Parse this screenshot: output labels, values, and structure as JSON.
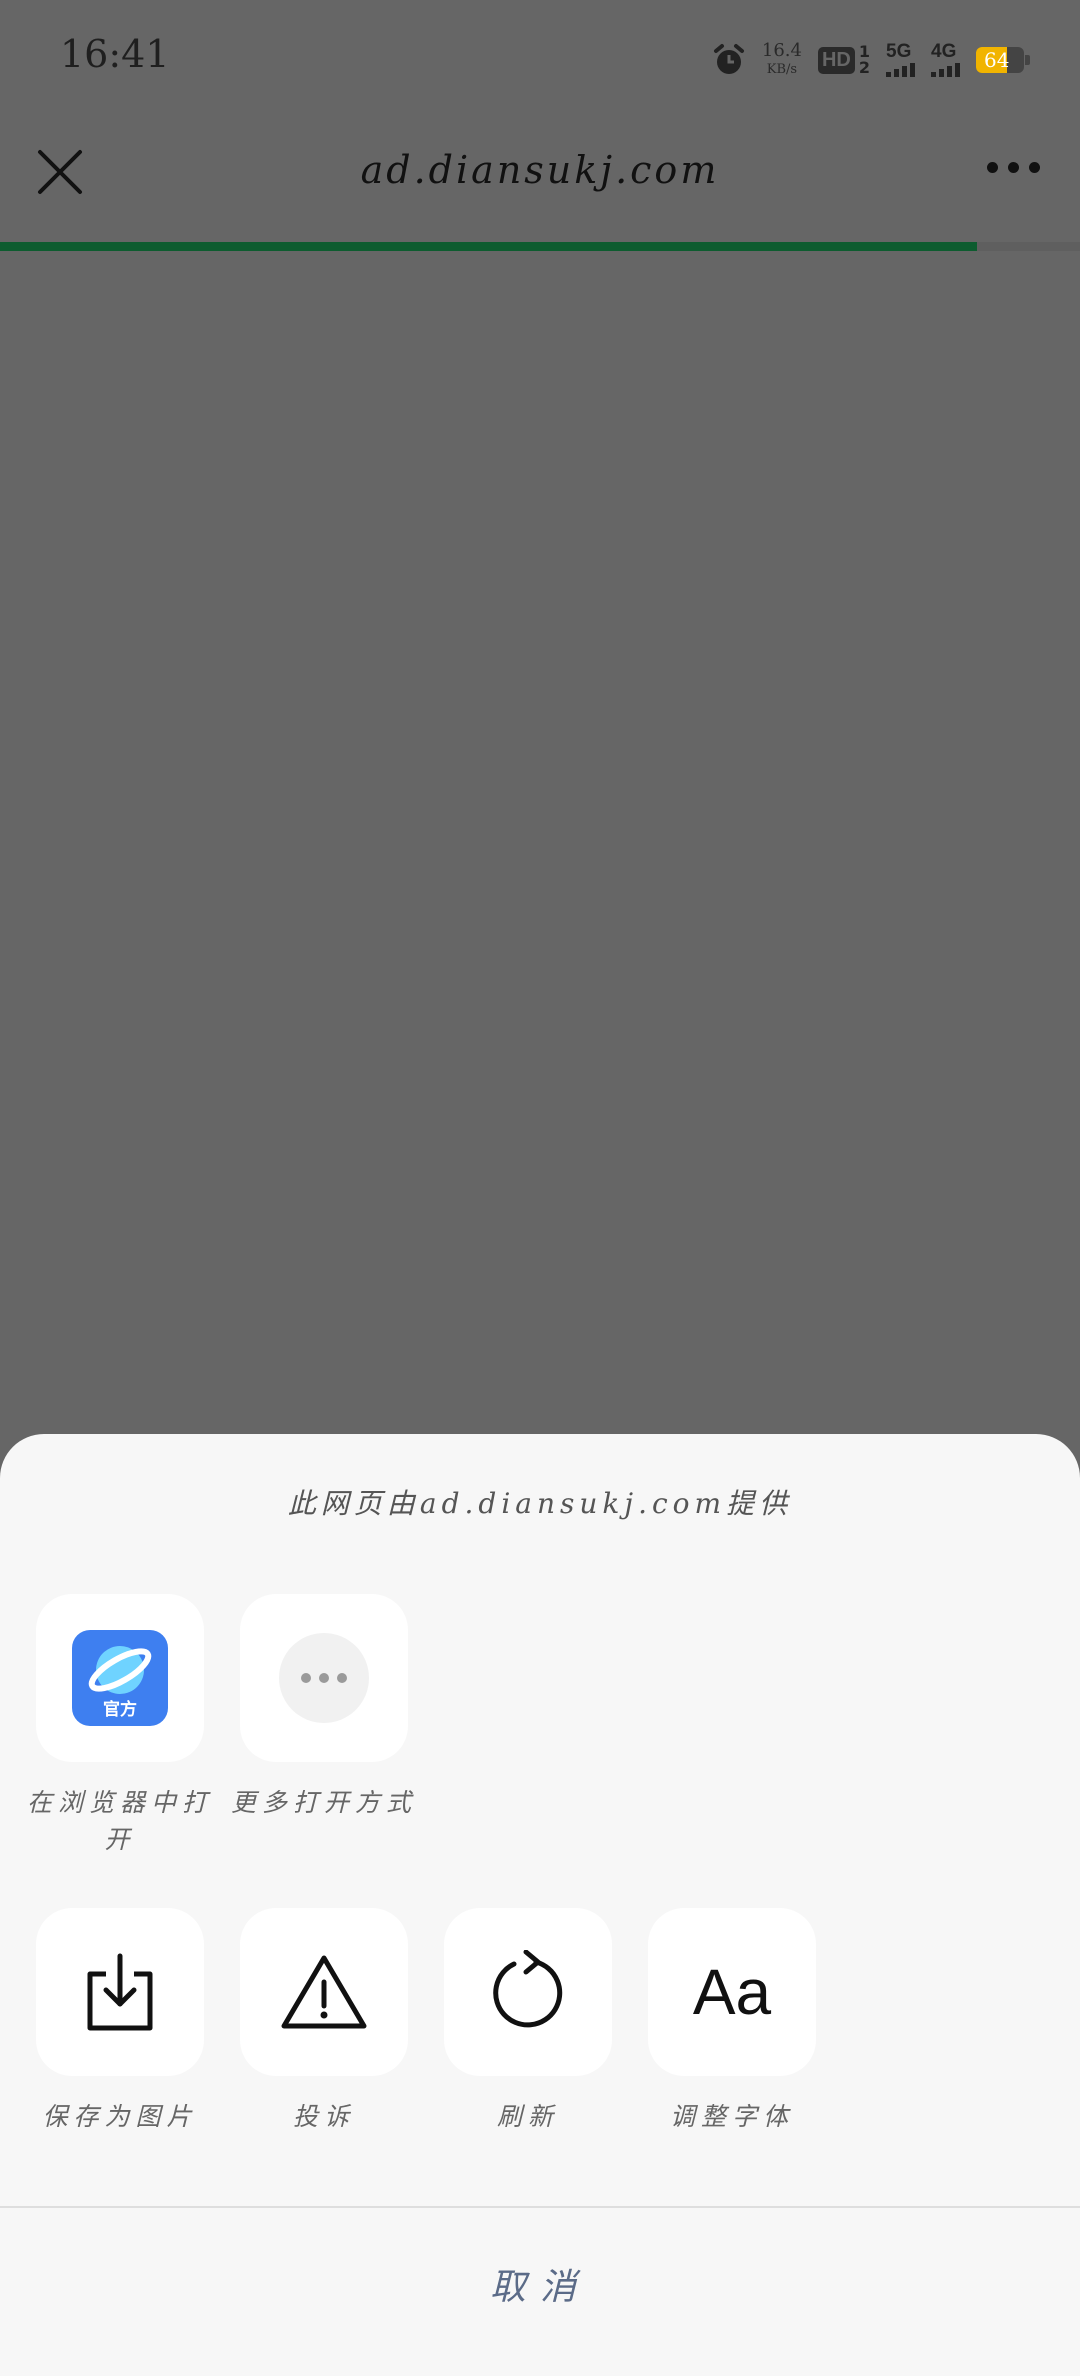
{
  "status_bar": {
    "time": "16:41",
    "speed_value": "16.4",
    "speed_unit": "KB/s",
    "hd": "HD",
    "hd_top": "1",
    "hd_bottom": "2",
    "network_1": "5G",
    "network_2": "4G",
    "battery": "64",
    "battery_fraction": 0.64
  },
  "title_bar": {
    "url": "ad.diansukj.com",
    "load_progress": 0.905
  },
  "sheet": {
    "title": "此网页由ad.diansukj.com提供",
    "row1": [
      {
        "label": "在浏览器中打开",
        "icon": "browser-icon",
        "badge": "官方"
      },
      {
        "label": "更多打开方式",
        "icon": "more-dots-icon"
      }
    ],
    "row2": [
      {
        "label": "保存为图片",
        "icon": "save-image-icon"
      },
      {
        "label": "投诉",
        "icon": "warning-icon"
      },
      {
        "label": "刷新",
        "icon": "refresh-icon"
      },
      {
        "label": "调整字体",
        "icon": "font-size-icon",
        "glyph": "Aa"
      }
    ],
    "cancel": "取消"
  },
  "colors": {
    "progress": "#0d5c2f",
    "overlay": "#666666",
    "sheet_bg": "#f7f7f7",
    "cancel_text": "#5b6b88",
    "battery": "#f1b400",
    "browser_icon": "#3e7ff0"
  }
}
